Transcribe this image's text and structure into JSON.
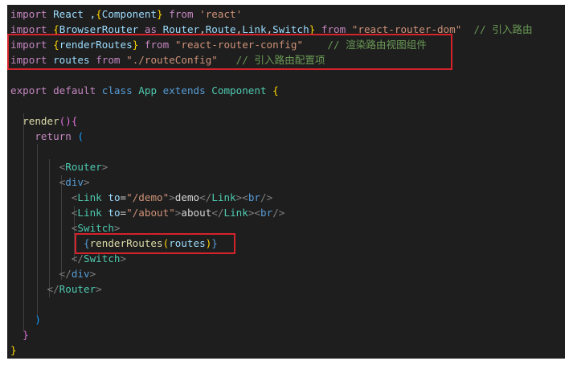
{
  "lines": [
    [
      {
        "t": "import",
        "c": "kw"
      },
      {
        "t": " React ,",
        "c": "id"
      },
      {
        "t": "{",
        "c": "br1"
      },
      {
        "t": "Component",
        "c": "id"
      },
      {
        "t": "}",
        "c": "br1"
      },
      {
        "t": " ",
        "c": "pun"
      },
      {
        "t": "from",
        "c": "kw"
      },
      {
        "t": " ",
        "c": "pun"
      },
      {
        "t": "'react'",
        "c": "str"
      }
    ],
    [
      {
        "t": "import",
        "c": "kw"
      },
      {
        "t": " ",
        "c": "pun"
      },
      {
        "t": "{",
        "c": "br1"
      },
      {
        "t": "BrowserRouter",
        "c": "id"
      },
      {
        "t": " ",
        "c": "pun"
      },
      {
        "t": "as",
        "c": "kw"
      },
      {
        "t": " ",
        "c": "pun"
      },
      {
        "t": "Router",
        "c": "id"
      },
      {
        "t": ",",
        "c": "pun"
      },
      {
        "t": "Route",
        "c": "id"
      },
      {
        "t": ",",
        "c": "pun"
      },
      {
        "t": "Link",
        "c": "id"
      },
      {
        "t": ",",
        "c": "pun"
      },
      {
        "t": "Switch",
        "c": "id"
      },
      {
        "t": "}",
        "c": "br1"
      },
      {
        "t": " ",
        "c": "pun"
      },
      {
        "t": "from",
        "c": "kw"
      },
      {
        "t": " ",
        "c": "pun"
      },
      {
        "t": "\"react-router-dom\"",
        "c": "str"
      },
      {
        "t": "  ",
        "c": "pun"
      },
      {
        "t": "// 引入路由",
        "c": "cmt"
      }
    ],
    [
      {
        "t": "import",
        "c": "kw"
      },
      {
        "t": " ",
        "c": "pun"
      },
      {
        "t": "{",
        "c": "br1"
      },
      {
        "t": "renderRoutes",
        "c": "id"
      },
      {
        "t": "}",
        "c": "br1"
      },
      {
        "t": " ",
        "c": "pun"
      },
      {
        "t": "from",
        "c": "kw"
      },
      {
        "t": " ",
        "c": "pun"
      },
      {
        "t": "\"react-router-config\"",
        "c": "str"
      },
      {
        "t": "    ",
        "c": "pun"
      },
      {
        "t": "// 渲染路由视图组件",
        "c": "cmt"
      }
    ],
    [
      {
        "t": "import",
        "c": "kw"
      },
      {
        "t": " ",
        "c": "pun"
      },
      {
        "t": "routes",
        "c": "id"
      },
      {
        "t": " ",
        "c": "pun"
      },
      {
        "t": "from",
        "c": "kw"
      },
      {
        "t": " ",
        "c": "pun"
      },
      {
        "t": "\"./routeConfig\"",
        "c": "str"
      },
      {
        "t": "   ",
        "c": "pun"
      },
      {
        "t": "// 引入路由配置项",
        "c": "cmt"
      }
    ],
    [],
    [
      {
        "t": "export",
        "c": "kw"
      },
      {
        "t": " ",
        "c": "pun"
      },
      {
        "t": "default",
        "c": "kw"
      },
      {
        "t": " ",
        "c": "pun"
      },
      {
        "t": "class",
        "c": "kwb"
      },
      {
        "t": " ",
        "c": "pun"
      },
      {
        "t": "App",
        "c": "cls"
      },
      {
        "t": " ",
        "c": "pun"
      },
      {
        "t": "extends",
        "c": "kwb"
      },
      {
        "t": " ",
        "c": "pun"
      },
      {
        "t": "Component",
        "c": "cls"
      },
      {
        "t": " ",
        "c": "pun"
      },
      {
        "t": "{",
        "c": "br1"
      }
    ],
    [],
    [
      {
        "t": "  ",
        "c": "pun"
      },
      {
        "t": "render",
        "c": "fn"
      },
      {
        "t": "()",
        "c": "br2"
      },
      {
        "t": "{",
        "c": "br2"
      }
    ],
    [
      {
        "t": "    ",
        "c": "pun"
      },
      {
        "t": "return",
        "c": "kw"
      },
      {
        "t": " ",
        "c": "pun"
      },
      {
        "t": "(",
        "c": "br3"
      }
    ],
    [],
    [
      {
        "t": "        ",
        "c": "pun"
      },
      {
        "t": "<",
        "c": "tagc"
      },
      {
        "t": "Router",
        "c": "cls"
      },
      {
        "t": ">",
        "c": "tagc"
      }
    ],
    [
      {
        "t": "        ",
        "c": "pun"
      },
      {
        "t": "<",
        "c": "tagc"
      },
      {
        "t": "div",
        "c": "tag"
      },
      {
        "t": ">",
        "c": "tagc"
      }
    ],
    [
      {
        "t": "          ",
        "c": "pun"
      },
      {
        "t": "<",
        "c": "tagc"
      },
      {
        "t": "Link",
        "c": "cls"
      },
      {
        "t": " ",
        "c": "pun"
      },
      {
        "t": "to",
        "c": "attr"
      },
      {
        "t": "=",
        "c": "pun"
      },
      {
        "t": "\"/demo\"",
        "c": "str"
      },
      {
        "t": ">",
        "c": "tagc"
      },
      {
        "t": "demo",
        "c": "pun"
      },
      {
        "t": "</",
        "c": "tagc"
      },
      {
        "t": "Link",
        "c": "cls"
      },
      {
        "t": ">",
        "c": "tagc"
      },
      {
        "t": "<",
        "c": "tagc"
      },
      {
        "t": "br",
        "c": "tag"
      },
      {
        "t": "/>",
        "c": "tagc"
      }
    ],
    [
      {
        "t": "          ",
        "c": "pun"
      },
      {
        "t": "<",
        "c": "tagc"
      },
      {
        "t": "Link",
        "c": "cls"
      },
      {
        "t": " ",
        "c": "pun"
      },
      {
        "t": "to",
        "c": "attr"
      },
      {
        "t": "=",
        "c": "pun"
      },
      {
        "t": "\"/about\"",
        "c": "str"
      },
      {
        "t": ">",
        "c": "tagc"
      },
      {
        "t": "about",
        "c": "pun"
      },
      {
        "t": "</",
        "c": "tagc"
      },
      {
        "t": "Link",
        "c": "cls"
      },
      {
        "t": ">",
        "c": "tagc"
      },
      {
        "t": "<",
        "c": "tagc"
      },
      {
        "t": "br",
        "c": "tag"
      },
      {
        "t": "/>",
        "c": "tagc"
      }
    ],
    [
      {
        "t": "          ",
        "c": "pun"
      },
      {
        "t": "<",
        "c": "tagc"
      },
      {
        "t": "Switch",
        "c": "cls"
      },
      {
        "t": ">",
        "c": "tagc"
      }
    ],
    [
      {
        "t": "            ",
        "c": "pun"
      },
      {
        "t": "{",
        "c": "tag"
      },
      {
        "t": "renderRoutes",
        "c": "fn"
      },
      {
        "t": "(",
        "c": "br1"
      },
      {
        "t": "routes",
        "c": "id"
      },
      {
        "t": ")",
        "c": "br1"
      },
      {
        "t": "}",
        "c": "tag"
      }
    ],
    [
      {
        "t": "          ",
        "c": "pun"
      },
      {
        "t": "</",
        "c": "tagc"
      },
      {
        "t": "Switch",
        "c": "cls"
      },
      {
        "t": ">",
        "c": "tagc"
      }
    ],
    [
      {
        "t": "        ",
        "c": "pun"
      },
      {
        "t": "</",
        "c": "tagc"
      },
      {
        "t": "div",
        "c": "tag"
      },
      {
        "t": ">",
        "c": "tagc"
      }
    ],
    [
      {
        "t": "      ",
        "c": "pun"
      },
      {
        "t": "</",
        "c": "tagc"
      },
      {
        "t": "Router",
        "c": "cls"
      },
      {
        "t": ">",
        "c": "tagc"
      }
    ],
    [],
    [
      {
        "t": "    ",
        "c": "pun"
      },
      {
        "t": ")",
        "c": "br3"
      }
    ],
    [
      {
        "t": "  ",
        "c": "pun"
      },
      {
        "t": "}",
        "c": "br2"
      }
    ],
    [
      {
        "t": "}",
        "c": "br1"
      }
    ]
  ]
}
